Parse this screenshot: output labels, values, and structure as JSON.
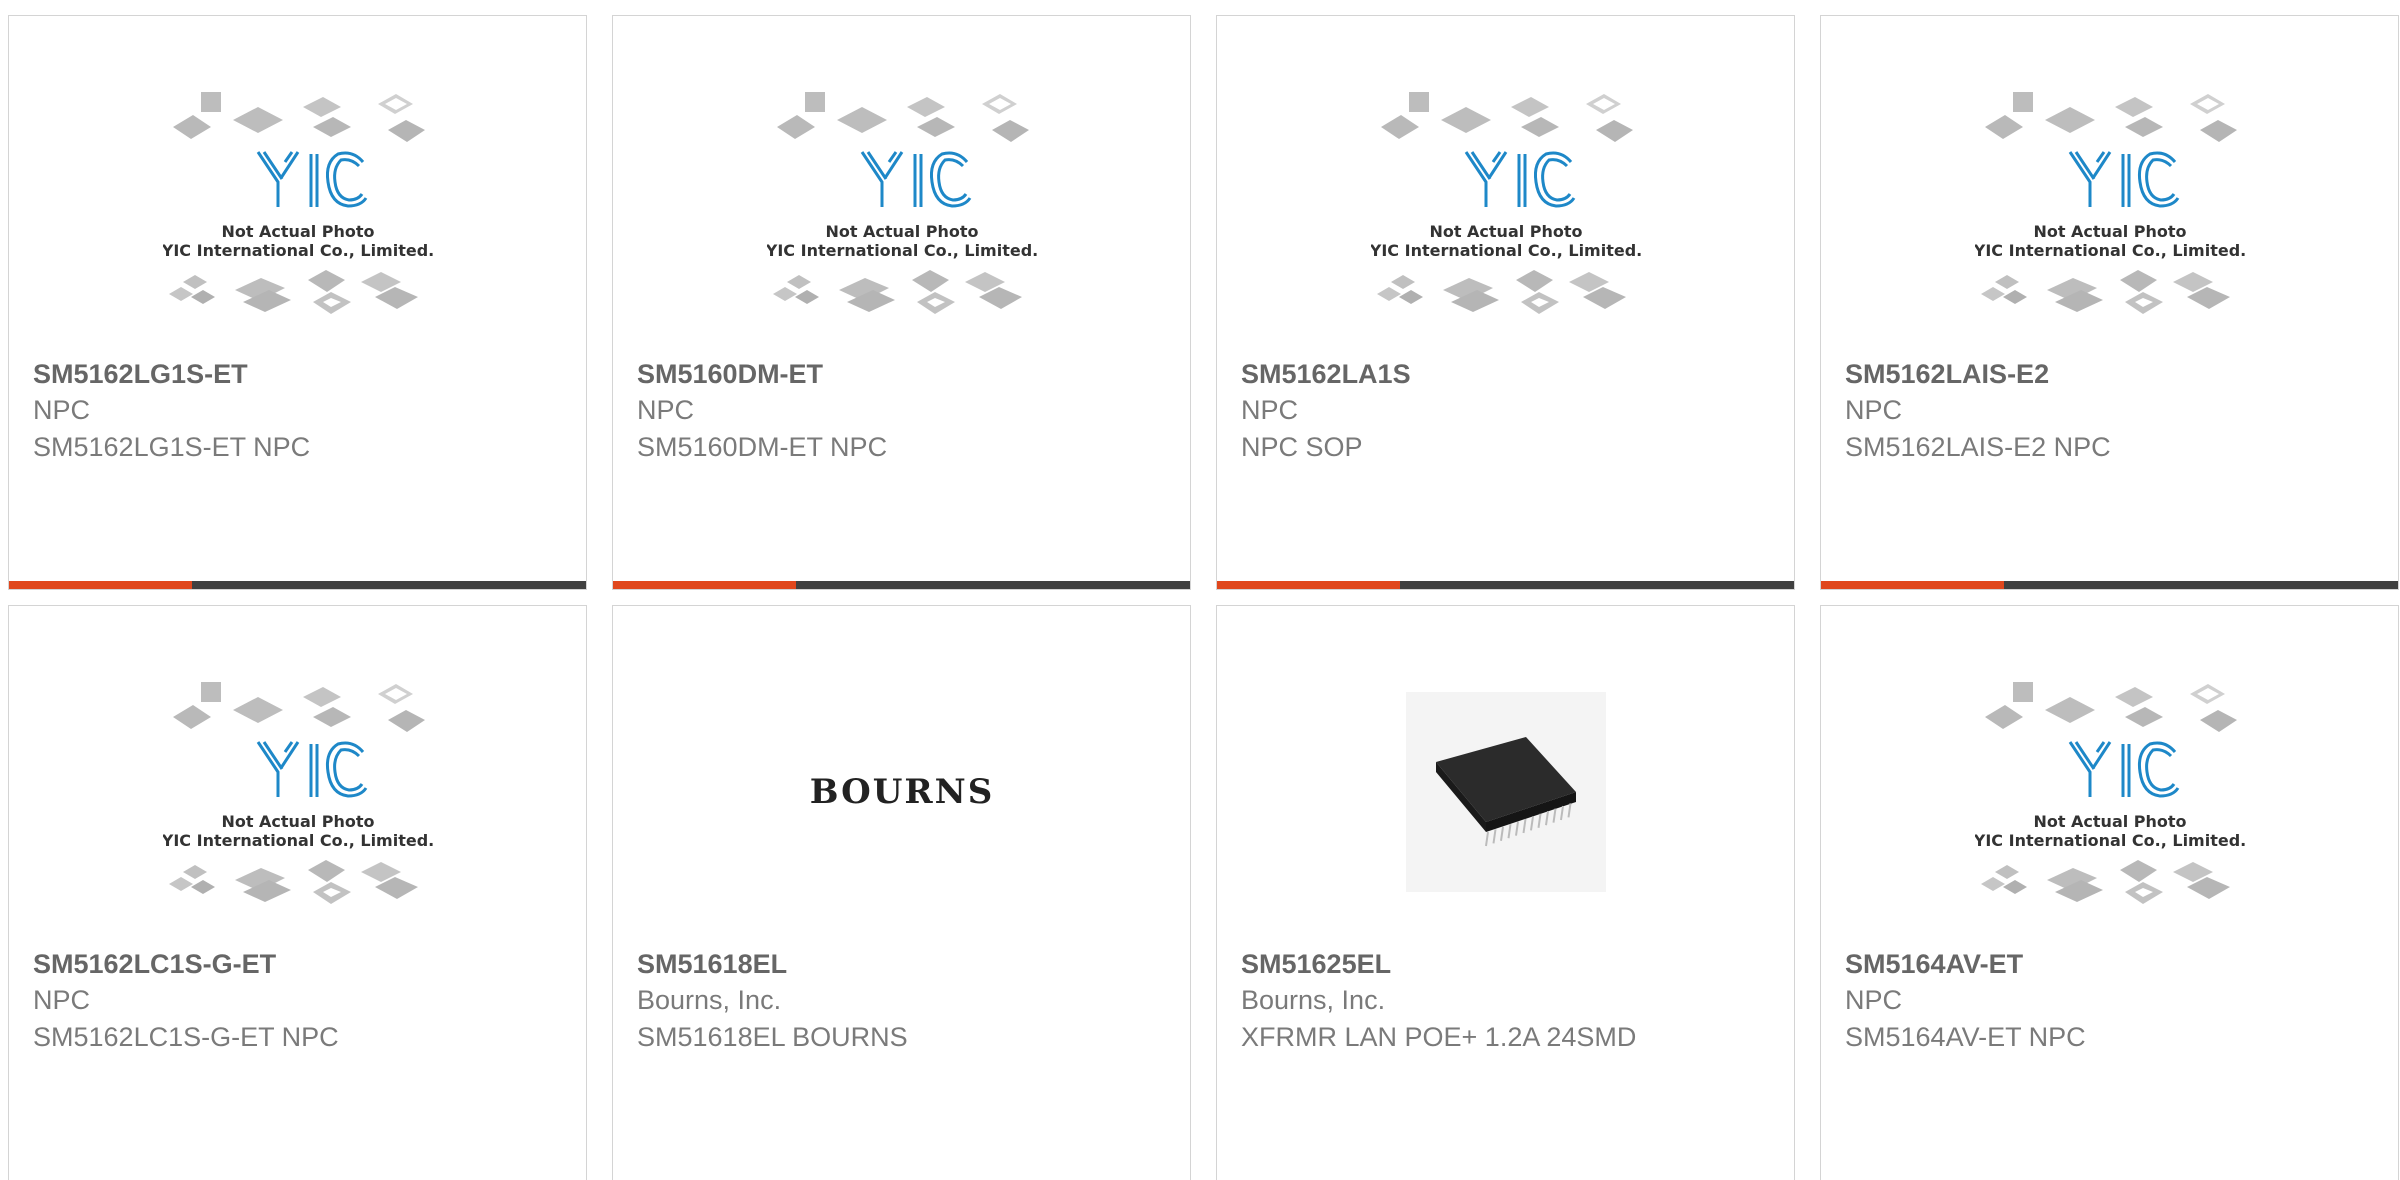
{
  "placeholder": {
    "line1": "Not Actual Photo",
    "line2": "YIC International Co., Limited.",
    "logo": "YIC"
  },
  "brand_logo": "BOURNS",
  "colors": {
    "accent": "#e0471d",
    "bar": "#404040",
    "logo_blue": "#1e88c8"
  },
  "products": [
    {
      "name": "SM5162LG1S-ET",
      "manufacturer": "NPC",
      "description": "SM5162LG1S-ET NPC",
      "image": "yic-placeholder"
    },
    {
      "name": "SM5160DM-ET",
      "manufacturer": "NPC",
      "description": "SM5160DM-ET NPC",
      "image": "yic-placeholder"
    },
    {
      "name": "SM5162LA1S",
      "manufacturer": "NPC",
      "description": "NPC SOP",
      "image": "yic-placeholder"
    },
    {
      "name": "SM5162LAIS-E2",
      "manufacturer": "NPC",
      "description": "SM5162LAIS-E2 NPC",
      "image": "yic-placeholder"
    },
    {
      "name": "SM5162LC1S-G-ET",
      "manufacturer": "NPC",
      "description": "SM5162LC1S-G-ET NPC",
      "image": "yic-placeholder"
    },
    {
      "name": "SM51618EL",
      "manufacturer": "Bourns, Inc.",
      "description": "SM51618EL BOURNS",
      "image": "bourns-logo"
    },
    {
      "name": "SM51625EL",
      "manufacturer": "Bourns, Inc.",
      "description": "XFRMR LAN POE+ 1.2A 24SMD",
      "image": "chip-photo"
    },
    {
      "name": "SM5164AV-ET",
      "manufacturer": "NPC",
      "description": "SM5164AV-ET NPC",
      "image": "yic-placeholder"
    }
  ]
}
